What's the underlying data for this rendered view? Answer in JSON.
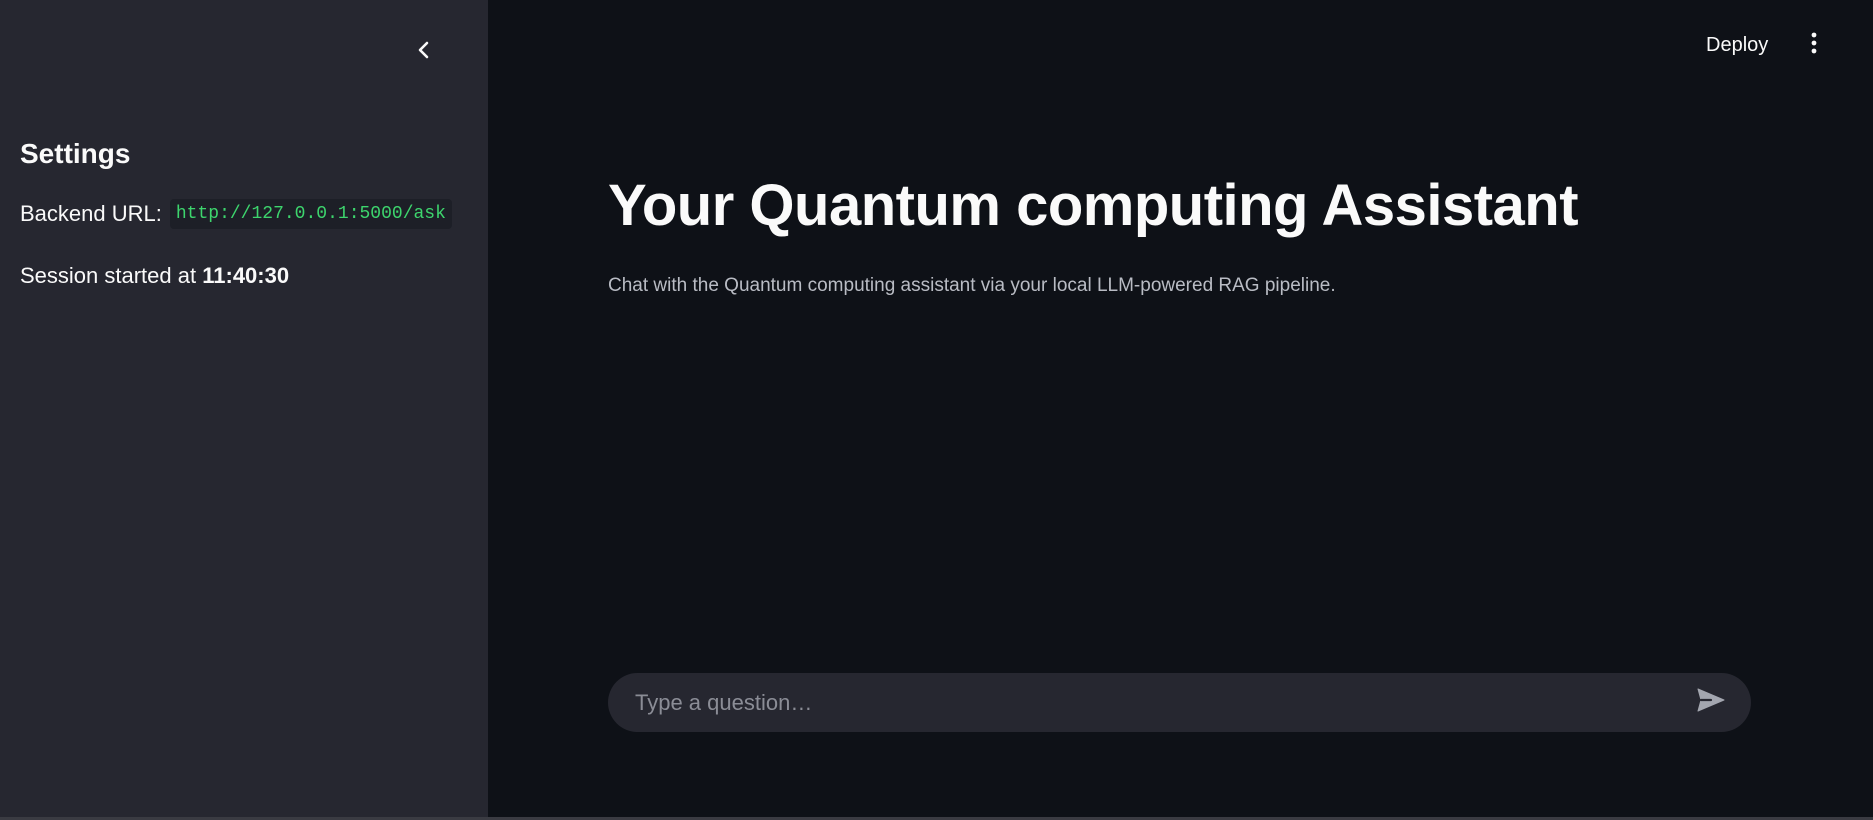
{
  "sidebar": {
    "title": "Settings",
    "backend_label": "Backend URL:",
    "backend_url": "http://127.0.0.1:5000/ask",
    "session_prefix": "Session started at",
    "session_time": "11:40:30",
    "collapse_icon": "chevron-left-icon"
  },
  "header": {
    "deploy_label": "Deploy",
    "menu_icon": "kebab-menu-icon"
  },
  "main": {
    "title": "Your Quantum computing Assistant",
    "subtitle": "Chat with the Quantum computing assistant via your local LLM-powered RAG pipeline."
  },
  "chat": {
    "placeholder": "Type a question…",
    "value": "",
    "send_icon": "send-icon"
  },
  "colors": {
    "sidebar_bg": "#262730",
    "main_bg": "#0e1117",
    "code_text": "#3dd56d",
    "text": "#fafafa",
    "muted_text": "#b9bcc4"
  }
}
